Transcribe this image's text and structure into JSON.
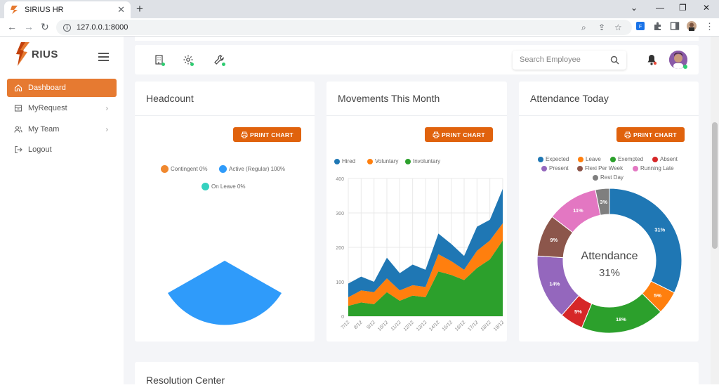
{
  "browser": {
    "tab_title": "SIRIUS HR",
    "url": "127.0.0.1:8000"
  },
  "app": {
    "logo_text": "RIUS",
    "brand_color": "#e67a31"
  },
  "sidebar": {
    "items": [
      {
        "label": "Dashboard",
        "icon": "home-icon",
        "active": true
      },
      {
        "label": "MyRequest",
        "icon": "inbox-icon",
        "has_children": true
      },
      {
        "label": "My Team",
        "icon": "users-icon",
        "has_children": true
      },
      {
        "label": "Logout",
        "icon": "logout-icon"
      }
    ]
  },
  "toolbar": {
    "search_placeholder": "Search Employee"
  },
  "cards": {
    "headcount": {
      "title": "Headcount",
      "print_label": "PRINT CHART"
    },
    "movements": {
      "title": "Movements This Month",
      "print_label": "PRINT CHART"
    },
    "attendance": {
      "title": "Attendance Today",
      "print_label": "PRINT CHART"
    },
    "resolution": {
      "title": "Resolution Center"
    }
  },
  "chart_data": [
    {
      "type": "pie",
      "legend": [
        {
          "name": "Contingent 0%",
          "color": "#f0882f"
        },
        {
          "name": "Active (Regular) 100%",
          "color": "#2f9bfa"
        },
        {
          "name": "On Leave 0%",
          "color": "#34d1bf"
        }
      ],
      "values": [
        0,
        100,
        0
      ]
    },
    {
      "type": "area",
      "categories": [
        "7/12",
        "8/12",
        "9/12",
        "10/12",
        "11/12",
        "12/12",
        "13/12",
        "14/12",
        "15/12",
        "16/12",
        "17/12",
        "18/12",
        "19/12"
      ],
      "series": [
        {
          "name": "Hired",
          "color": "#1f77b4",
          "values": [
            40,
            40,
            30,
            60,
            50,
            60,
            50,
            60,
            50,
            40,
            70,
            60,
            100
          ]
        },
        {
          "name": "Voluntary",
          "color": "#ff7f0e",
          "values": [
            25,
            35,
            35,
            40,
            30,
            30,
            30,
            50,
            40,
            30,
            50,
            55,
            50
          ]
        },
        {
          "name": "Involuntary",
          "color": "#2ca02c",
          "values": [
            30,
            40,
            35,
            70,
            45,
            60,
            55,
            130,
            120,
            105,
            140,
            165,
            220
          ]
        }
      ],
      "yticks": [
        0,
        100,
        200,
        300,
        400
      ],
      "ylim": [
        0,
        400
      ]
    },
    {
      "type": "pie",
      "center_label": "Attendance",
      "center_value": "31%",
      "legend": [
        {
          "name": "Expected",
          "color": "#1f77b4"
        },
        {
          "name": "Leave",
          "color": "#ff7f0e"
        },
        {
          "name": "Exempted",
          "color": "#2ca02c"
        },
        {
          "name": "Absent",
          "color": "#d62728"
        },
        {
          "name": "Present",
          "color": "#9467bd"
        },
        {
          "name": "Flexi Per Week",
          "color": "#8c564b"
        },
        {
          "name": "Running Late",
          "color": "#e377c2"
        },
        {
          "name": "Rest Day",
          "color": "#7f7f7f"
        }
      ],
      "values": [
        31,
        5,
        18,
        5,
        14,
        9,
        11,
        3
      ],
      "labels": [
        "31%",
        "5%",
        "18%",
        "5%",
        "14%",
        "9%",
        "11%",
        "3%"
      ]
    }
  ]
}
